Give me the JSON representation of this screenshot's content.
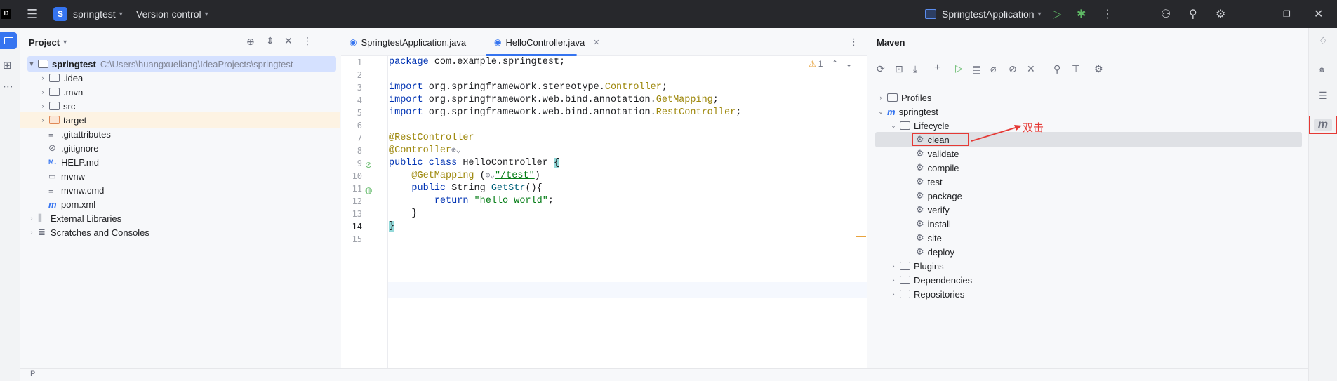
{
  "titlebar": {
    "app_logo": "IJ",
    "menu_icon": "hamburger-icon",
    "project_initial": "S",
    "project_name": "springtest",
    "vcs_label": "Version control",
    "run_config": "SpringtestApplication",
    "window_controls": [
      "minimize",
      "restore",
      "close"
    ]
  },
  "project_panel": {
    "title": "Project",
    "root": {
      "name": "springtest",
      "path": "C:\\Users\\huangxueliang\\IdeaProjects\\springtest"
    },
    "items": [
      {
        "label": ".idea",
        "kind": "folder"
      },
      {
        "label": ".mvn",
        "kind": "folder"
      },
      {
        "label": "src",
        "kind": "folder"
      },
      {
        "label": "target",
        "kind": "folder-excluded"
      },
      {
        "label": ".gitattributes",
        "kind": "file"
      },
      {
        "label": ".gitignore",
        "kind": "file"
      },
      {
        "label": "HELP.md",
        "kind": "file"
      },
      {
        "label": "mvnw",
        "kind": "file"
      },
      {
        "label": "mvnw.cmd",
        "kind": "file"
      },
      {
        "label": "pom.xml",
        "kind": "file"
      }
    ],
    "external_libraries": "External Libraries",
    "scratches": "Scratches and Consoles",
    "status_hint": "P"
  },
  "editor": {
    "tabs": [
      {
        "label": "SpringtestApplication.java",
        "active": false
      },
      {
        "label": "HelloController.java",
        "active": true
      }
    ],
    "warning_count": "1",
    "lines": [
      "1",
      "2",
      "3",
      "4",
      "5",
      "6",
      "7",
      "8",
      "9",
      "10",
      "11",
      "12",
      "13",
      "14",
      "15"
    ],
    "code": {
      "l1_kw": "package",
      "l1_rest": " com.example.springtest;",
      "l3_kw": "import",
      "l3_pre": " org.springframework.stereotype.",
      "l3_ann": "Controller",
      "l3_end": ";",
      "l4_kw": "import",
      "l4_pre": " org.springframework.web.bind.annotation.",
      "l4_ann": "GetMapping",
      "l4_end": ";",
      "l5_kw": "import",
      "l5_pre": " org.springframework.web.bind.annotation.",
      "l5_ann": "RestController",
      "l5_end": ";",
      "l7": "@RestController",
      "l8": "@Controller",
      "l9_kw": "public class",
      "l9_rest": " HelloController ",
      "l9_brace": "{",
      "l10_ann": "@GetMapping",
      "l10_open": " (",
      "l10_str": "\"/test\"",
      "l10_close": ")",
      "l11_kw": "public",
      "l11_type": " String ",
      "l11_method": "GetStr",
      "l11_rest": "(){",
      "l12_kw": "return",
      "l12_str": "\"hello world\"",
      "l12_end": ";",
      "l13": "}",
      "l14": "}"
    }
  },
  "maven_panel": {
    "title": "Maven",
    "profiles": "Profiles",
    "project": "springtest",
    "lifecycle": "Lifecycle",
    "phases": [
      "clean",
      "validate",
      "compile",
      "test",
      "package",
      "verify",
      "install",
      "site",
      "deploy"
    ],
    "plugins": "Plugins",
    "dependencies": "Dependencies",
    "repositories": "Repositories",
    "annotation": "双击"
  },
  "colors": {
    "accent": "#3574f0",
    "titlebar_bg": "#27282c",
    "annotation_red": "#e53935"
  }
}
